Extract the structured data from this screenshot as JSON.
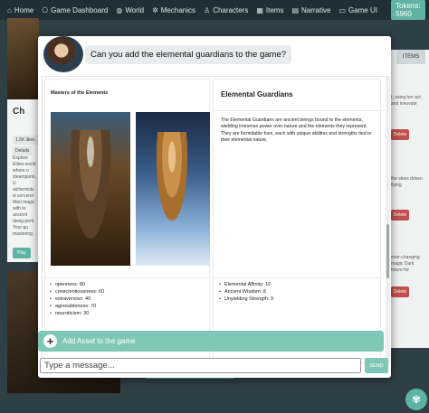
{
  "nav": {
    "items": [
      {
        "icon": "home-icon",
        "glyph": "⌂",
        "label": "Home"
      },
      {
        "icon": "gamepad-icon",
        "glyph": "⎔",
        "label": "Game Dashboard"
      },
      {
        "icon": "globe-icon",
        "glyph": "◍",
        "label": "World"
      },
      {
        "icon": "gear-icon",
        "glyph": "✲",
        "label": "Mechanics"
      },
      {
        "icon": "character-icon",
        "glyph": "♙",
        "label": "Characters"
      },
      {
        "icon": "items-icon",
        "glyph": "▦",
        "label": "Items"
      },
      {
        "icon": "narrative-icon",
        "glyph": "▤",
        "label": "Narrative"
      },
      {
        "icon": "monitor-icon",
        "glyph": "▭",
        "label": "Game UI"
      }
    ],
    "tokens": "Tokens: 5960"
  },
  "background": {
    "left_title": "Ch",
    "chip_likes": "1.5K likes",
    "chip_details": "Details",
    "left_text": "Explore Elites world where o steampunk, U alchemists w sorcerer Mari magic with te ancient desig peril. Your qu mastering the",
    "play_label": "Play",
    "items_tab": "ITEMS",
    "right_texts": [
      "t, using her act and innovate",
      "the skies driven flying",
      "ever-changing magic Dark future for"
    ],
    "delete_label": "Delete"
  },
  "modal": {
    "question": "Can you add the elemental guardians to the game?",
    "left_card": {
      "title": "Masters of the Elements",
      "stats": [
        "openness: 80",
        "conscientiousness: 60",
        "extraversion: 40",
        "agreeableness: 70",
        "neuroticism: 30"
      ]
    },
    "right_card": {
      "title": "Elemental Guardians",
      "description": "The Elemental Guardians are ancient beings bound to the elements, wielding immense power over nature and the elements they represent. They are formidable foes, each with unique abilities and strengths tied to their elemental nature.",
      "stats": [
        "Elemental Affinity: 10",
        "Ancient Wisdom: 8",
        "Unyielding Strength: 9"
      ]
    },
    "add_asset_label": "Add Asset to the game",
    "input_placeholder": "Type a message...",
    "send_label": "SEND"
  }
}
